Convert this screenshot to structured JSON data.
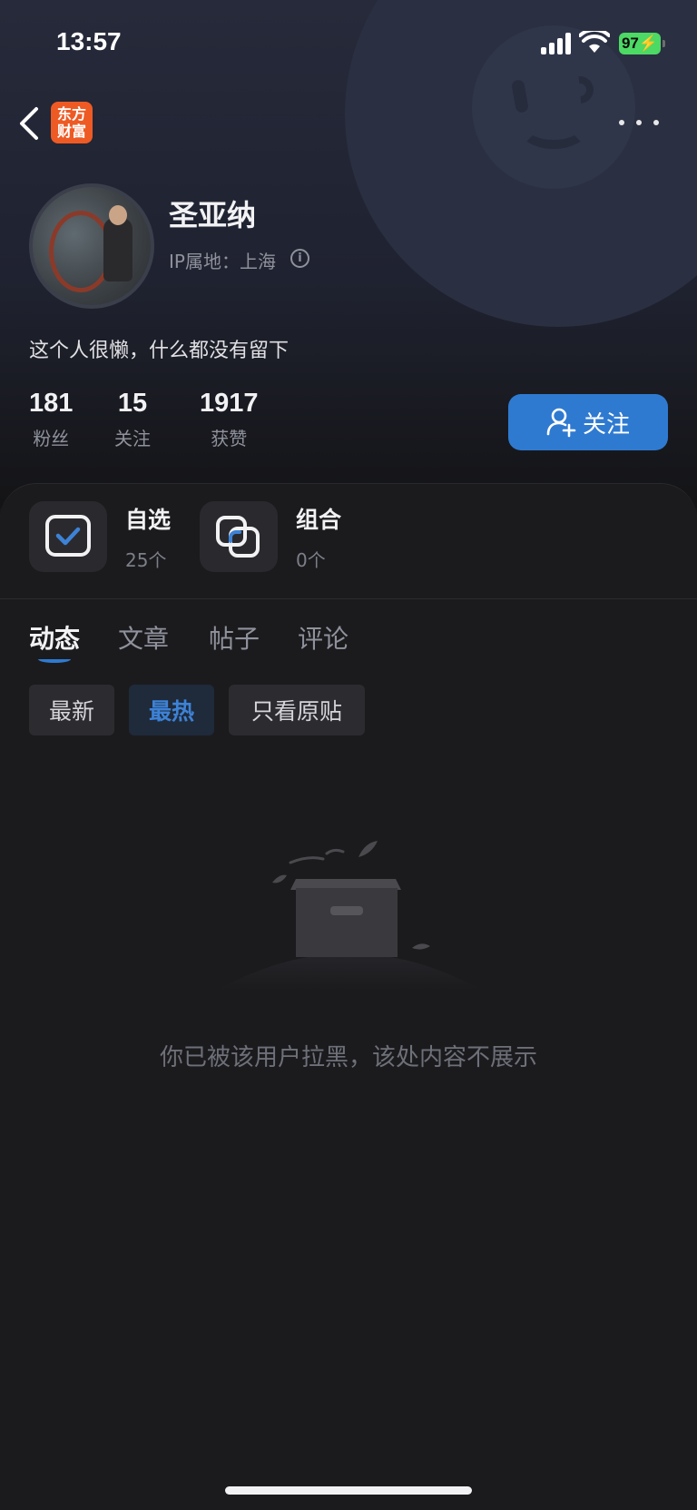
{
  "status_bar": {
    "time": "13:57",
    "battery": "97"
  },
  "app": {
    "logo_line1": "东方",
    "logo_line2": "财富"
  },
  "profile": {
    "name": "圣亚纳",
    "ip_location": "IP属地：上海",
    "bio": "这个人很懒，什么都没有留下"
  },
  "stats": [
    {
      "value": "181",
      "label": "粉丝"
    },
    {
      "value": "15",
      "label": "关注"
    },
    {
      "value": "1917",
      "label": "获赞"
    }
  ],
  "follow_button": "关注",
  "quick_links": [
    {
      "title": "自选",
      "subtitle": "25个",
      "icon": "watchlist-check-icon"
    },
    {
      "title": "组合",
      "subtitle": "0个",
      "icon": "portfolio-icon"
    }
  ],
  "tabs": [
    {
      "label": "动态",
      "active": true
    },
    {
      "label": "文章",
      "active": false
    },
    {
      "label": "帖子",
      "active": false
    },
    {
      "label": "评论",
      "active": false
    }
  ],
  "filters": [
    {
      "label": "最新",
      "active": false
    },
    {
      "label": "最热",
      "active": true
    },
    {
      "label": "只看原贴",
      "active": false
    }
  ],
  "empty_state": {
    "message": "你已被该用户拉黑，该处内容不展示"
  },
  "colors": {
    "accent": "#2f7ad1",
    "background": "#18181b",
    "battery": "#4cd964",
    "logo": "#ee5a24"
  }
}
